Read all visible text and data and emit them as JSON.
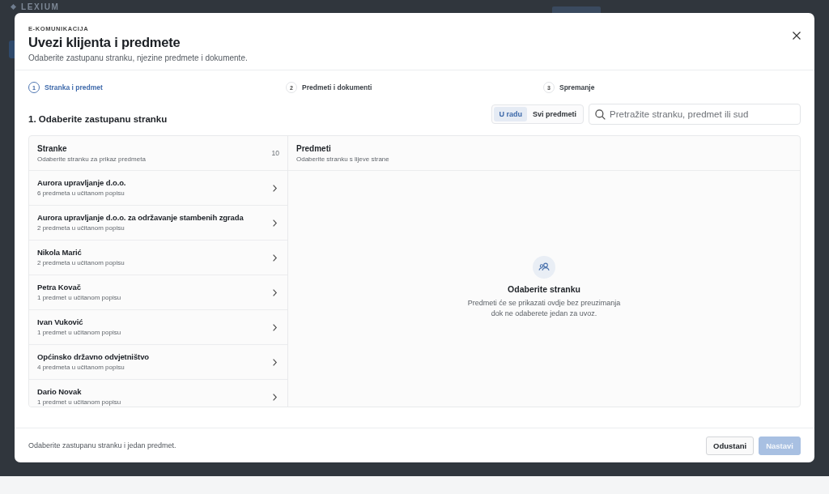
{
  "backdrop": {
    "brand": "LEXIUM"
  },
  "dialog": {
    "eyebrow": "E-KOMUNIKACIJA",
    "title": "Uvezi klijenta i predmete",
    "subtitle": "Odaberite zastupanu stranku, njezine predmete i dokumente."
  },
  "steps": [
    {
      "number": "1",
      "label": "Stranka i predmet",
      "selected": true
    },
    {
      "number": "2",
      "label": "Predmeti i dokumenti",
      "selected": false
    },
    {
      "number": "3",
      "label": "Spremanje",
      "selected": false
    }
  ],
  "section": {
    "title": "1. Odaberite zastupanu stranku"
  },
  "filter_tabs": [
    {
      "label": "U radu",
      "selected": true
    },
    {
      "label": "Svi predmeti",
      "selected": false
    }
  ],
  "search": {
    "placeholder": "Pretražite stranku, predmet ili sud"
  },
  "clients_panel": {
    "title": "Stranke",
    "subtitle": "Odaberite stranku za prikaz predmeta",
    "count": "10",
    "items": [
      {
        "name": "Aurora upravljanje d.o.o.",
        "detail": "6 predmeta u učitanom popisu",
        "selected": false
      },
      {
        "name": "Aurora upravljanje d.o.o. za održavanje stambenih zgrada",
        "detail": "2 predmeta u učitanom popisu",
        "selected": false
      },
      {
        "name": "Nikola Marić",
        "detail": "2 predmeta u učitanom popisu",
        "selected": false
      },
      {
        "name": "Petra Kovač",
        "detail": "1 predmet u učitanom popisu",
        "selected": false
      },
      {
        "name": "Ivan Vuković",
        "detail": "1 predmet u učitanom popisu",
        "selected": false
      },
      {
        "name": "Općinsko državno odvjetništvo",
        "detail": "4 predmeta u učitanom popisu",
        "selected": false
      },
      {
        "name": "Dario Novak",
        "detail": "1 predmet u učitanom popisu",
        "selected": false
      }
    ]
  },
  "cases_panel": {
    "title": "Predmeti",
    "subtitle": "Odaberite stranku s lijeve strane",
    "empty_title": "Odaberite stranku",
    "empty_text": "Predmeti će se prikazati ovdje bez preuzimanja dok ne odaberete jedan za uvoz."
  },
  "footer": {
    "hint": "Odaberite zastupanu stranku i jedan predmet.",
    "buttons": [
      {
        "label": "Odustani",
        "kind": "secondary",
        "disabled": false
      },
      {
        "label": "Nastavi",
        "kind": "primary",
        "disabled": true
      }
    ]
  }
}
